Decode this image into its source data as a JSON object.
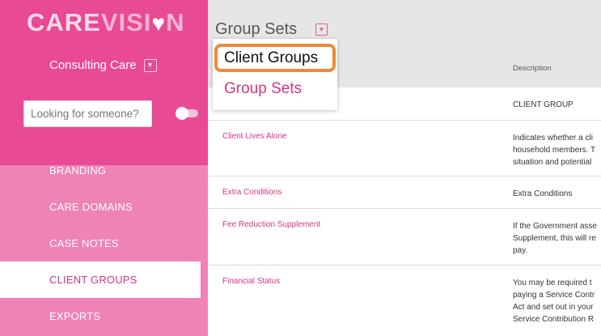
{
  "brand": {
    "care": "CARE",
    "vision": "VISI",
    "heart": "♥",
    "n": "N"
  },
  "org": {
    "name": "Consulting Care",
    "caret_icon": "chevron-down-icon"
  },
  "search": {
    "placeholder": "Looking for someone?"
  },
  "nav": {
    "items": [
      {
        "label": "BRANDING",
        "active": false
      },
      {
        "label": "CARE DOMAINS",
        "active": false
      },
      {
        "label": "CASE NOTES",
        "active": false
      },
      {
        "label": "CLIENT GROUPS",
        "active": true
      },
      {
        "label": "EXPORTS",
        "active": false
      }
    ]
  },
  "main": {
    "title": "Group Sets",
    "caret_icon": "chevron-down-icon",
    "columns": {
      "description": "Description"
    },
    "rows": [
      {
        "name": "",
        "description": "CLIENT GROUP"
      },
      {
        "name": "Client Lives Alone",
        "description": "Indicates whether a cli\nhousehold members. T\nsituation and potential"
      },
      {
        "name": "Extra Conditions",
        "description": "Extra Conditions"
      },
      {
        "name": "Fee Reduction Supplement",
        "description": "If the Government asse\nSupplement, this will re\npay."
      },
      {
        "name": "Financial Status",
        "description": "You may be required t\npaying a Service Contr\nAct and set out in your\nService Contribution R"
      }
    ]
  },
  "dropdown": {
    "options": [
      {
        "label": "Client Groups",
        "highlighted": true
      },
      {
        "label": "Group Sets",
        "highlighted": false
      }
    ]
  },
  "colors": {
    "brand_pink": "#e84a93",
    "sidebar_light": "#ef83b5",
    "accent_text": "#d6337f",
    "highlight_border": "#ee8a35"
  }
}
